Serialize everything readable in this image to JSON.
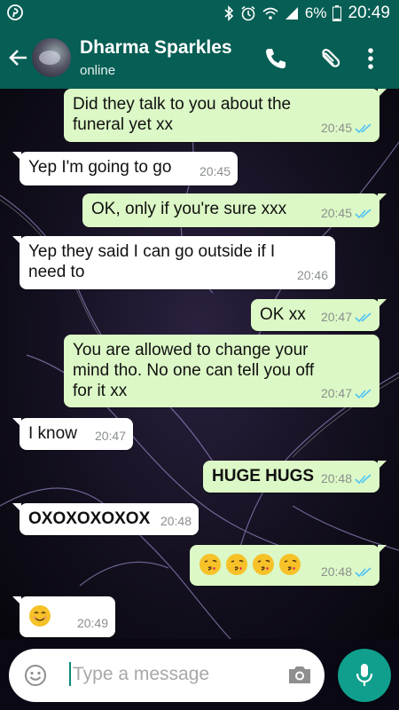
{
  "status_bar": {
    "battery_percent": "6%",
    "time": "20:49"
  },
  "contact": {
    "name": "Dharma Sparkles",
    "status": "online"
  },
  "messages": [
    {
      "direction": "out",
      "lines": [
        "Did they talk  to you  about the",
        "funeral yet  xx"
      ],
      "time": "20:45",
      "read": true
    },
    {
      "direction": "in",
      "lines": [
        "Yep I'm going to  go"
      ],
      "time": "20:45"
    },
    {
      "direction": "out",
      "lines": [
        "OK,   only  if you're  sure xxx"
      ],
      "time": "20:45",
      "read": true
    },
    {
      "direction": "in",
      "lines": [
        "Yep they said I can go outside if I",
        "need to"
      ],
      "time": "20:46"
    },
    {
      "direction": "out",
      "lines": [
        "OK  xx"
      ],
      "time": "20:47",
      "read": true
    },
    {
      "direction": "out",
      "lines": [
        "You are allowed  to change  your",
        "mind  tho.  No one  can tell you  off",
        "for it xx"
      ],
      "time": "20:47",
      "read": true
    },
    {
      "direction": "in",
      "lines": [
        "I know"
      ],
      "time": "20:47"
    },
    {
      "direction": "out",
      "lines": [
        "HUGE HUGS"
      ],
      "time": "20:48",
      "read": true
    },
    {
      "direction": "in",
      "lines": [
        "OXOXOXOXOX"
      ],
      "time": "20:48"
    },
    {
      "direction": "out",
      "emojis": [
        "face-blowing-kiss",
        "face-blowing-kiss",
        "face-blowing-kiss",
        "face-blowing-kiss"
      ],
      "time": "20:48",
      "read": true
    },
    {
      "direction": "in",
      "emojis": [
        "smiling-face"
      ],
      "time": "20:49"
    }
  ],
  "composer": {
    "placeholder": "Type a message"
  },
  "icons": {
    "back": "arrow-left-icon",
    "call": "phone-icon",
    "attach": "paperclip-icon",
    "menu": "more-vertical-icon",
    "emoji": "emoji-icon",
    "camera": "camera-icon",
    "mic": "microphone-icon"
  },
  "colors": {
    "header": "#075e54",
    "outgoing_bubble": "#dcf8c6",
    "incoming_bubble": "#ffffff",
    "read_ticks": "#4fc3f7",
    "mic_button": "#0f9f8c"
  }
}
